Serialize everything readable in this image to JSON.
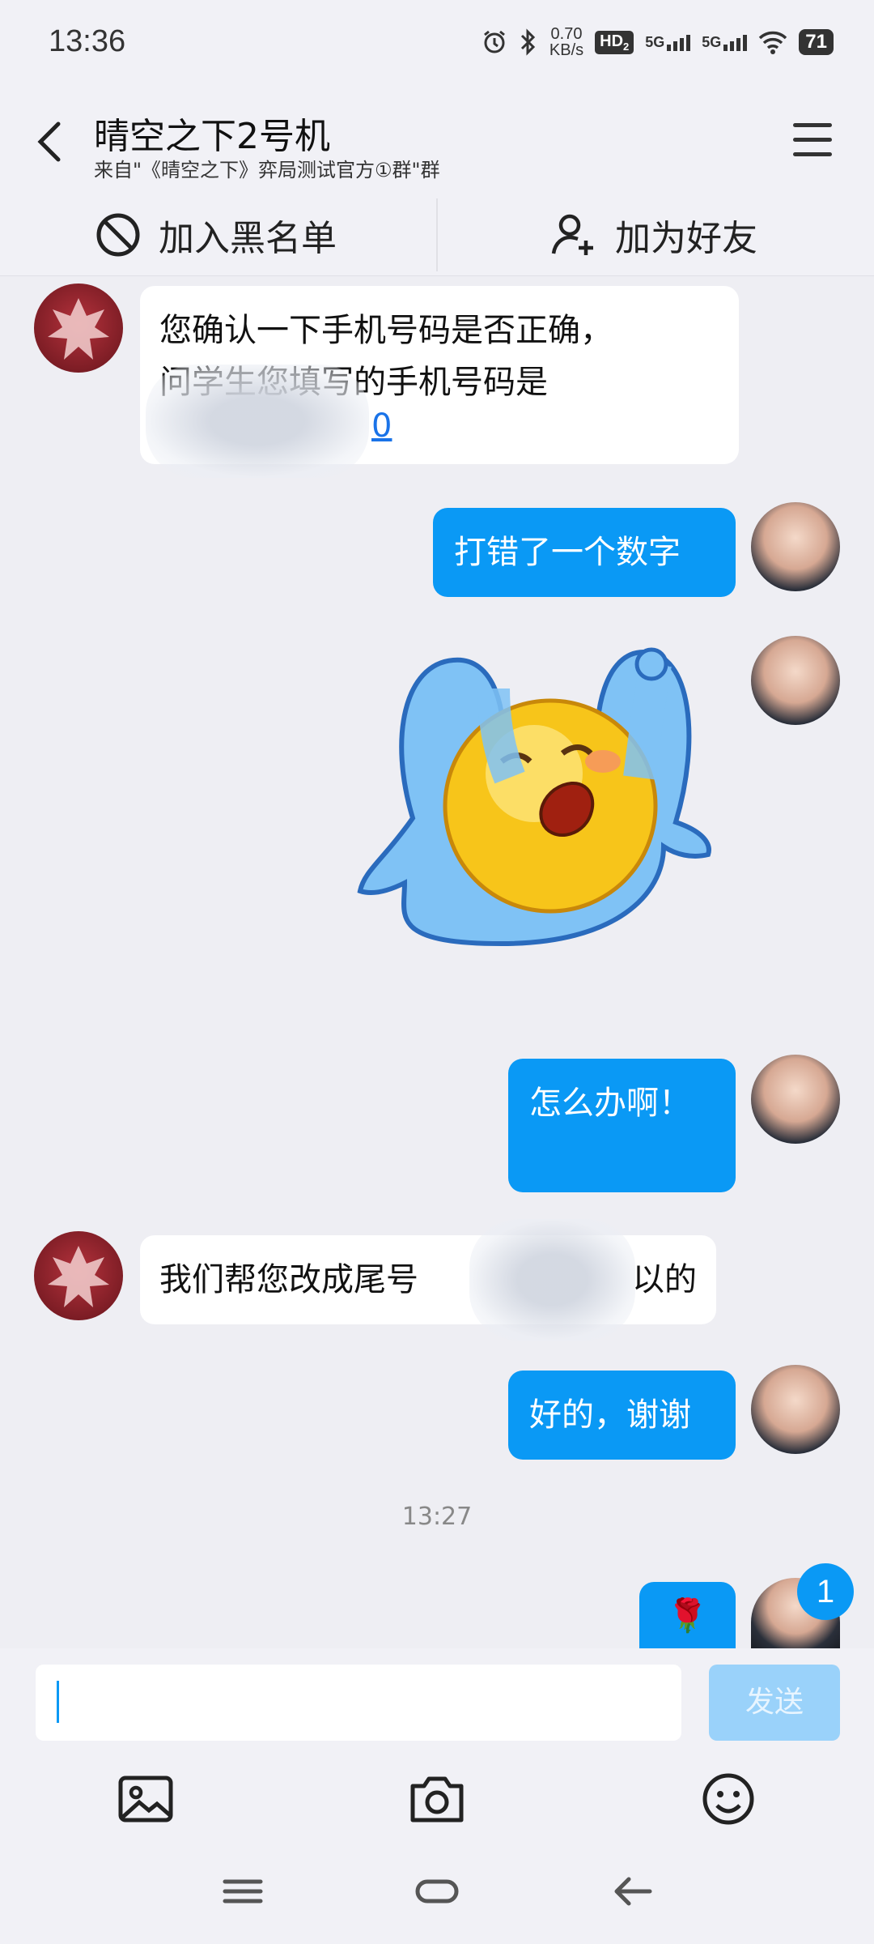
{
  "status_bar": {
    "time": "13:36",
    "net_speed_value": "0.70",
    "net_speed_unit": "KB/s",
    "hd_label": "HD",
    "hd_sub": "2",
    "sim1_label": "5G",
    "sim2_label": "5G",
    "battery": "71"
  },
  "header": {
    "title": "晴空之下2号机",
    "subtitle": "来自\"《晴空之下》弈局测试官方①群\"群"
  },
  "actions": {
    "blacklist_label": "加入黑名单",
    "add_friend_label": "加为好友"
  },
  "messages": {
    "m1_line1": "您确认一下手机号码是否正确，",
    "m1_line2": "问学生您填写的手机号码是",
    "m1_link_tail": "0",
    "m2": "打错了一个数字",
    "m3_sticker": "crying-emoji-sticker",
    "m4": "怎么办啊！",
    "m5_prefix": "我们帮您改成尾号",
    "m5_suffix": "以的",
    "m6": "好的，谢谢",
    "timestamp": "13:27",
    "m7": "🌹"
  },
  "unread_badge": "1",
  "composer": {
    "input_value": "",
    "send_label": "发送"
  },
  "colors": {
    "accent": "#0a99f5",
    "background": "#eeeef3",
    "send_disabled": "#9ad2fa"
  }
}
